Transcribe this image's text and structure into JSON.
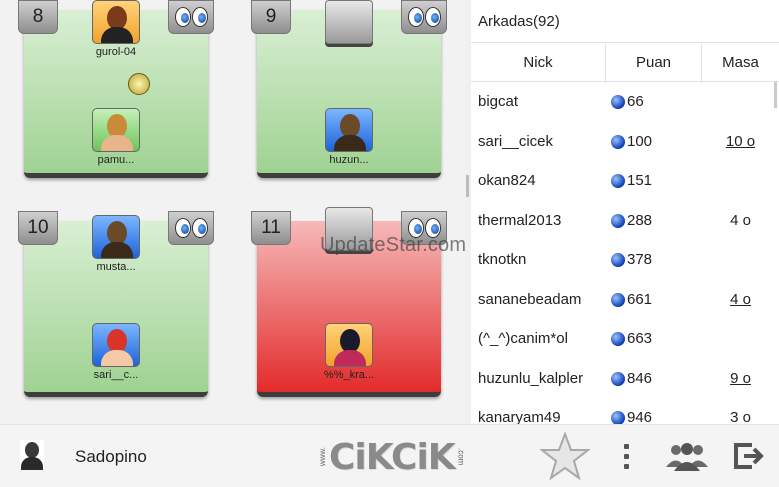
{
  "tables": [
    {
      "number": "8",
      "status": "green",
      "top_seat": {
        "name": "gurol-04",
        "avatar": "orange-avatar"
      },
      "center_icon": "ball-icon",
      "bottom_seat": {
        "name": "pamu...",
        "avatar": "green-avatar"
      }
    },
    {
      "number": "9",
      "status": "green",
      "top_seat": null,
      "bottom_seat": {
        "name": "huzun...",
        "avatar": "blue-avatar"
      }
    },
    {
      "number": "10",
      "status": "green",
      "top_seat": {
        "name": "musta...",
        "avatar": "blue-avatar"
      },
      "bottom_seat": {
        "name": "sari__c...",
        "avatar": "blue-avatar"
      }
    },
    {
      "number": "11",
      "status": "red",
      "top_seat": null,
      "bottom_seat": {
        "name": "%%_kra...",
        "avatar": "orange-avatar"
      }
    }
  ],
  "watermark": "UpdateStar.com",
  "friends": {
    "title": "Arkadas(92)",
    "columns": {
      "nick": "Nick",
      "puan": "Puan",
      "masa": "Masa"
    },
    "rows": [
      {
        "nick": "bigcat",
        "puan": "66",
        "masa": "",
        "masa_link": false
      },
      {
        "nick": "sari__cicek",
        "puan": "100",
        "masa": "10 o",
        "masa_link": true
      },
      {
        "nick": "okan824",
        "puan": "151",
        "masa": "",
        "masa_link": false
      },
      {
        "nick": "thermal2013",
        "puan": "288",
        "masa": "4 o",
        "masa_link": false
      },
      {
        "nick": "tknotkn",
        "puan": "378",
        "masa": "",
        "masa_link": false
      },
      {
        "nick": "sananebeadam",
        "puan": "661",
        "masa": "4 o",
        "masa_link": true
      },
      {
        "nick": "(^_^)canim*ol",
        "puan": "663",
        "masa": "",
        "masa_link": false
      },
      {
        "nick": "huzunlu_kalpler",
        "puan": "846",
        "masa": "9 o",
        "masa_link": true
      },
      {
        "nick": "kanaryam49",
        "puan": "946",
        "masa": "3 o",
        "masa_link": false
      }
    ]
  },
  "bottom_bar": {
    "user_name": "Sadopino",
    "logo_text": "CiKCiK",
    "logo_prefix": "www.",
    "logo_suffix": ".com",
    "icons": [
      "star-icon",
      "more-vert-icon",
      "friends-icon",
      "exit-icon"
    ]
  },
  "colors": {
    "table_green": "#a8d69b",
    "table_red": "#e53535",
    "puan_dot": "#1346c8"
  }
}
